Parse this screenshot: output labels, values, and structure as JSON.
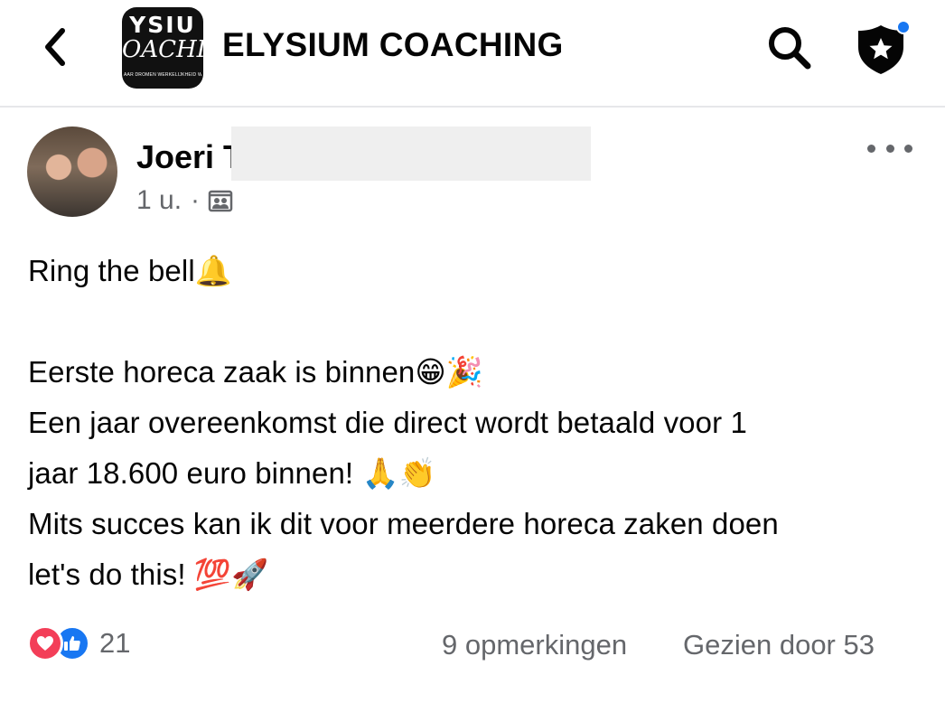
{
  "header": {
    "back_icon": "chevron-left-icon",
    "group_logo": {
      "line1": "YSIU",
      "line2": "OACHI",
      "tagline": "AAR DROMEN WERKELIJKHEID WORDE"
    },
    "group_name": "ELYSIUM COACHING",
    "search_icon": "search-icon",
    "shield_icon": "shield-star-icon",
    "notification_color": "#1877f2"
  },
  "post": {
    "author": "Joeri T",
    "time": "1 u.",
    "separator": "·",
    "audience_icon": "group-audience-icon",
    "more_icon": "more-horizontal-icon",
    "lines": [
      "Ring the bell🔔",
      "",
      "Eerste horeca zaak is binnen😁🎉",
      "Een jaar overeenkomst die direct wordt betaald voor 1",
      "jaar 18.600 euro binnen! 🙏👏",
      "Mits succes kan ik dit voor meerdere horeca zaken doen",
      "let's do this! 💯🚀"
    ]
  },
  "footer": {
    "reaction_icons": [
      "heart-reaction-icon",
      "like-reaction-icon"
    ],
    "reaction_count": "21",
    "comments": "9 opmerkingen",
    "seen_by": "Gezien door 53"
  },
  "colors": {
    "heart": "#f33e58",
    "like": "#1877f2",
    "secondary_text": "#65676b"
  }
}
